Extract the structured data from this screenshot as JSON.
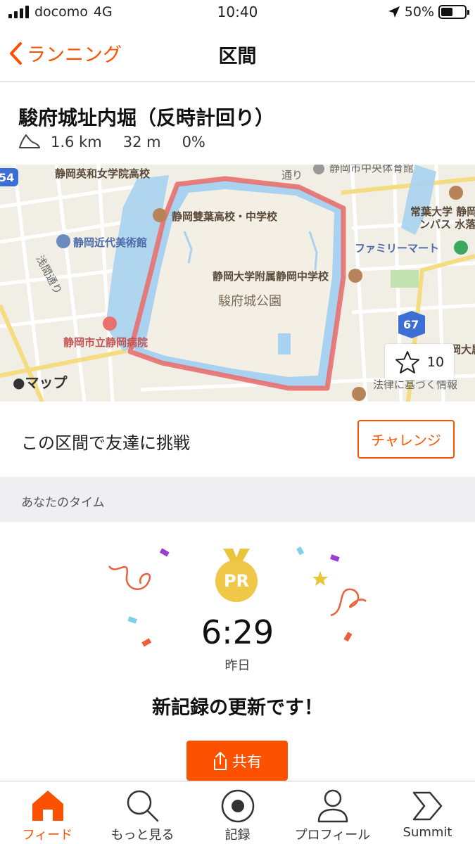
{
  "status_bar": {
    "carrier": "docomo",
    "network": "4G",
    "time": "10:40",
    "battery": "50%",
    "battery_level": 0.5
  },
  "nav": {
    "back_label": "ランニング",
    "title": "区間"
  },
  "segment": {
    "title": "駿府城址内堀（反時計回り）",
    "distance": "1.6 km",
    "elevation": "32 m",
    "grade": "0%"
  },
  "map": {
    "attribution": "マップ",
    "star_count": "10",
    "labels": {
      "school1": "静岡英和女学院高校",
      "gym": "静岡市中央体育館",
      "school2": "静岡雙葉高校・中学校",
      "uni": "常葉大学 静岡",
      "uni2": "ンパス 水落",
      "museum": "静岡近代美術館",
      "famima": "ファミリーマート",
      "school3": "静岡大学附属静岡中学校",
      "park": "駿府城公園",
      "hospital": "静岡市立静岡病院",
      "road1": "浅間通り",
      "road2": "通り",
      "route54": "54",
      "route67": "67",
      "law": "法律に基づく情報",
      "uni3": "岡大属"
    },
    "colors": {
      "route": "#e8706f",
      "water": "#a9d2f0",
      "park": "#f3efe4"
    }
  },
  "challenge": {
    "text": "この区間で友達に挑戦",
    "button": "チャレンジ"
  },
  "section_header": "あなたのタイム",
  "result": {
    "badge": "PR",
    "time": "6:29",
    "date": "昨日",
    "message": "新記録の更新です！",
    "share": "共有"
  },
  "tabs": [
    {
      "label": "フィード",
      "icon": "home-icon",
      "active": true
    },
    {
      "label": "もっと見る",
      "icon": "search-icon",
      "active": false
    },
    {
      "label": "記録",
      "icon": "record-icon",
      "active": false
    },
    {
      "label": "プロフィール",
      "icon": "profile-icon",
      "active": false
    },
    {
      "label": "Summit",
      "icon": "summit-icon",
      "active": false
    }
  ],
  "accent_color": "#fc5200"
}
